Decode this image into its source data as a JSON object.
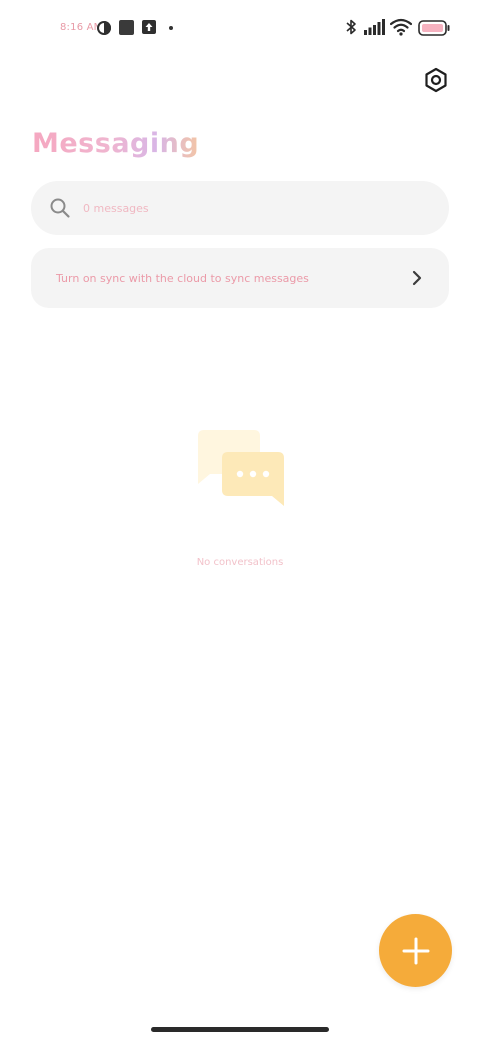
{
  "status_bar": {
    "time": "8:16 AM",
    "icons": [
      "theme-icon",
      "app-square-icon",
      "upload-icon",
      "dot-icon",
      "bluetooth-icon",
      "signal-icon",
      "wifi-icon",
      "battery-icon"
    ]
  },
  "header": {
    "title": "Messaging",
    "settings_icon": "settings-hexagon-icon"
  },
  "search": {
    "placeholder": "0 messages",
    "icon": "search-icon"
  },
  "sync_banner": {
    "text": "Turn on sync with the cloud to sync messages",
    "icon": "chevron-right-icon"
  },
  "empty_state": {
    "icon": "chat-bubbles-icon",
    "text": "No conversations"
  },
  "fab": {
    "icon": "plus-icon"
  },
  "colors": {
    "accent": "#f5ab3a",
    "surface": "#f4f4f4",
    "text_pink": "#eb9aa8",
    "illustration_light": "#fff6df",
    "illustration_main": "#fde9b8"
  }
}
